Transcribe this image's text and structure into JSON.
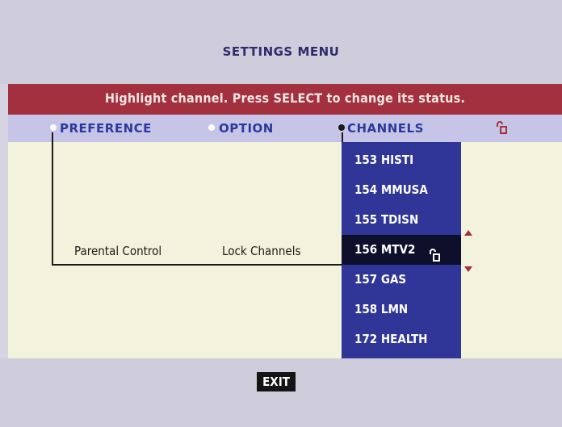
{
  "header": {
    "title": "SETTINGS MENU"
  },
  "instruction": "Highlight channel. Press SELECT to change its status.",
  "tabs": [
    {
      "label": "PREFERENCE"
    },
    {
      "label": "OPTION"
    },
    {
      "label": "CHANNELS"
    }
  ],
  "breadcrumb": {
    "parental_control": "Parental Control",
    "lock_channels": "Lock Channels"
  },
  "channels": [
    {
      "label": "153 HISTI"
    },
    {
      "label": "154 MMUSA"
    },
    {
      "label": "155 TDISN"
    },
    {
      "label": "156 MTV2",
      "locked": true,
      "selected": true
    },
    {
      "label": "157 GAS"
    },
    {
      "label": "158 LMN"
    },
    {
      "label": "172 HEALTH"
    }
  ],
  "footer": {
    "exit_label": "EXIT"
  },
  "icons": {
    "lock": "lock-icon",
    "scroll_up": "arrow-up-icon",
    "scroll_down": "arrow-down-icon"
  },
  "colors": {
    "accent_red": "#a3303e",
    "list_blue": "#2f3697",
    "selected": "#0e0f2b"
  }
}
